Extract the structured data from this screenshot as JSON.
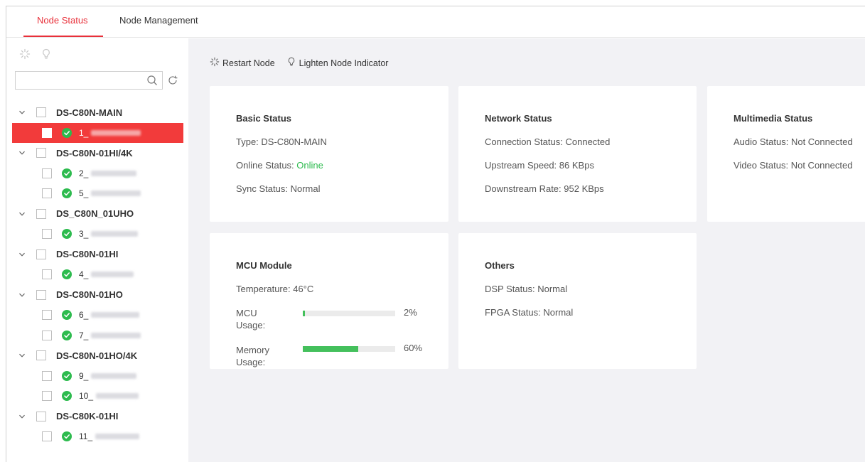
{
  "tabs": [
    {
      "label": "Node Status",
      "active": true
    },
    {
      "label": "Node Management",
      "active": false
    }
  ],
  "sidebar": {
    "tools": [
      "restart-icon",
      "bulb-icon"
    ],
    "search": {
      "value": "",
      "placeholder": ""
    },
    "groups": [
      {
        "name": "DS-C80N-MAIN",
        "nodes": [
          {
            "id": "1_",
            "selected": true
          }
        ]
      },
      {
        "name": "DS-C80N-01HI/4K",
        "nodes": [
          {
            "id": "2_"
          },
          {
            "id": "5_"
          }
        ]
      },
      {
        "name": "DS_C80N_01UHO",
        "nodes": [
          {
            "id": "3_"
          }
        ]
      },
      {
        "name": "DS-C80N-01HI",
        "nodes": [
          {
            "id": "4_"
          }
        ]
      },
      {
        "name": "DS-C80N-01HO",
        "nodes": [
          {
            "id": "6_"
          },
          {
            "id": "7_"
          }
        ]
      },
      {
        "name": "DS-C80N-01HO/4K",
        "nodes": [
          {
            "id": "9_"
          },
          {
            "id": "10_"
          }
        ]
      },
      {
        "name": "DS-C80K-01HI",
        "nodes": [
          {
            "id": "11_"
          }
        ]
      }
    ]
  },
  "toolbar": {
    "restart_label": "Restart Node",
    "lighten_label": "Lighten Node Indicator"
  },
  "basic": {
    "title": "Basic Status",
    "type_label": "Type:",
    "type_value": "DS-C80N-MAIN",
    "online_label": "Online Status:",
    "online_value": "Online",
    "sync_label": "Sync Status:",
    "sync_value": "Normal"
  },
  "network": {
    "title": "Network Status",
    "conn_label": "Connection Status:",
    "conn_value": "Connected",
    "up_label": "Upstream Speed:",
    "up_value": "86 KBps",
    "down_label": "Downstream Rate:",
    "down_value": "952 KBps"
  },
  "multimedia": {
    "title": "Multimedia Status",
    "audio_label": "Audio Status:",
    "audio_value": "Not Connected",
    "video_label": "Video Status:",
    "video_value": "Not Connected"
  },
  "mcu": {
    "title": "MCU Module",
    "temp_label": "Temperature:",
    "temp_value": "46°C",
    "usage_label": "MCU Usage:",
    "usage_value": "2%",
    "usage_fraction": 0.02,
    "mem_label": "Memory Usage:",
    "mem_value": "60%",
    "mem_fraction": 0.6
  },
  "others": {
    "title": "Others",
    "dsp_label": "DSP Status:",
    "dsp_value": "Normal",
    "fpga_label": "FPGA Status:",
    "fpga_value": "Normal"
  },
  "colors": {
    "accent": "#e8303a",
    "selected_row": "#f23b3b",
    "ok": "#2dbb4e",
    "progress": "#44c05c"
  }
}
